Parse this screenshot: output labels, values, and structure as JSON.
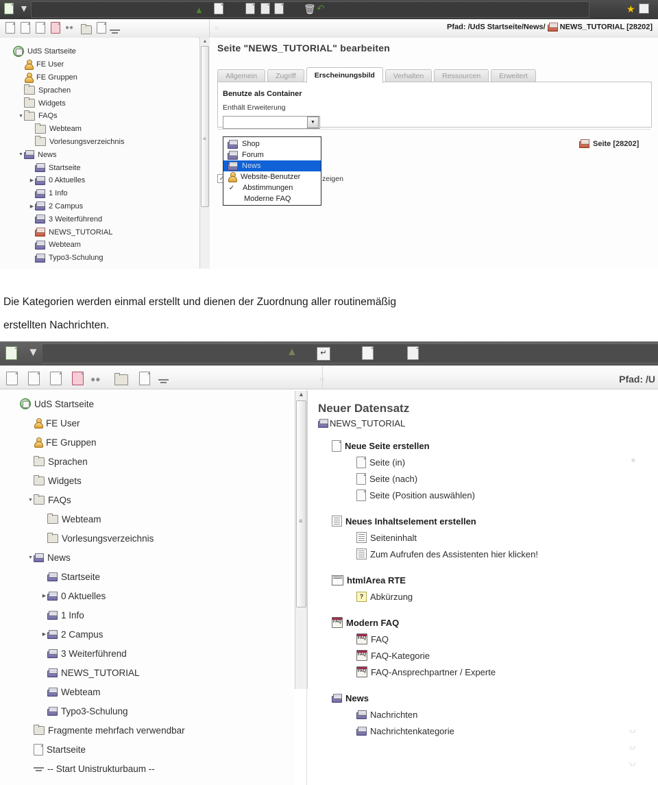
{
  "document": {
    "paragraph_line1": "Die Kategorien werden einmal erstellt und dienen der  Zuordnung aller routinemäßig",
    "paragraph_line2": "erstellten Nachrichten."
  },
  "screenshot1": {
    "toolbar_top": {
      "icons": [
        "new-page-icon",
        "filter-icon",
        "user-icon",
        "clipboard-icon",
        "save-document-icon",
        "save-and-view-icon",
        "save-and-close-icon",
        "delete-icon",
        "undo-icon",
        "bookmark-star-icon",
        "fullscreen-icon"
      ]
    },
    "toolbar_second": {
      "icons": [
        "page-icon",
        "page-edit-icon",
        "page-new-icon",
        "page-red-icon",
        "link-icon",
        "folder-icon",
        "info-icon",
        "divider-icon"
      ],
      "path_label": "Pfad:",
      "path_value": "/UdS Startseite/News/",
      "path_page": "NEWS_TUTORIAL [28202]"
    },
    "tree": {
      "items": [
        {
          "label": "UdS Startseite",
          "depth": 0,
          "icon": "globe-icon",
          "twist": ""
        },
        {
          "label": "FE User",
          "depth": 1,
          "icon": "user-icon",
          "twist": ""
        },
        {
          "label": "FE Gruppen",
          "depth": 1,
          "icon": "user-group-icon",
          "twist": ""
        },
        {
          "label": "Sprachen",
          "depth": 1,
          "icon": "folder-icon",
          "twist": ""
        },
        {
          "label": "Widgets",
          "depth": 1,
          "icon": "folder-icon",
          "twist": ""
        },
        {
          "label": "FAQs",
          "depth": 1,
          "icon": "folder-icon",
          "twist": "▼"
        },
        {
          "label": "Webteam",
          "depth": 2,
          "icon": "folder-icon",
          "twist": ""
        },
        {
          "label": "Vorlesungsverzeichnis",
          "depth": 2,
          "icon": "folder-icon",
          "twist": ""
        },
        {
          "label": "News",
          "depth": 1,
          "icon": "news-page-icon",
          "twist": "▼"
        },
        {
          "label": "Startseite",
          "depth": 2,
          "icon": "news-page-icon",
          "twist": ""
        },
        {
          "label": "0 Aktuelles",
          "depth": 2,
          "icon": "news-page-icon",
          "twist": "▶"
        },
        {
          "label": "1 Info",
          "depth": 2,
          "icon": "news-page-icon",
          "twist": ""
        },
        {
          "label": "2 Campus",
          "depth": 2,
          "icon": "news-page-icon",
          "twist": "▶"
        },
        {
          "label": "3 Weiterführend",
          "depth": 2,
          "icon": "news-page-icon",
          "twist": ""
        },
        {
          "label": "NEWS_TUTORIAL",
          "depth": 2,
          "icon": "news-page-red-icon",
          "twist": ""
        },
        {
          "label": "Webteam",
          "depth": 2,
          "icon": "news-page-icon",
          "twist": ""
        },
        {
          "label": "Typo3-Schulung",
          "depth": 2,
          "icon": "news-page-icon",
          "twist": ""
        }
      ]
    },
    "editor": {
      "heading": "Seite \"NEWS_TUTORIAL\" bearbeiten",
      "tabs": [
        {
          "label": "Allgemein",
          "active": false
        },
        {
          "label": "Zugriff",
          "active": false
        },
        {
          "label": "Erscheinungsbild",
          "active": true
        },
        {
          "label": "Verhalten",
          "active": false
        },
        {
          "label": "Ressourcen",
          "active": false
        },
        {
          "label": "Erweitert",
          "active": false
        }
      ],
      "field_group_label": "Benutze als Container",
      "field_label": "Enthält Erweiterung",
      "select_value": "",
      "dropdown_options": [
        {
          "label": "Shop",
          "icon": "shop-icon",
          "selected": false,
          "check": false
        },
        {
          "label": "Forum",
          "icon": "forum-icon",
          "selected": false,
          "check": false
        },
        {
          "label": "News",
          "icon": "news-icon",
          "selected": true,
          "check": false
        },
        {
          "label": "Website-Benutzer",
          "icon": "website-user-icon",
          "selected": false,
          "check": false
        },
        {
          "label": "Abstimmungen",
          "icon": "",
          "selected": false,
          "check": true
        },
        {
          "label": "Moderne FAQ",
          "icon": "",
          "selected": false,
          "check": false
        }
      ],
      "checkbox_row_text": "zeigen",
      "record_badge": "Seite [28202]"
    }
  },
  "screenshot2": {
    "toolbar_top": {
      "icons": [
        "new-page-icon",
        "filter-icon",
        "user-icon",
        "enter-icon",
        "new-record-icon",
        "history-icon"
      ]
    },
    "toolbar_second": {
      "icons": [
        "page-icon",
        "page-edit-icon",
        "page-new-icon",
        "page-red-icon",
        "link-icon",
        "folder-icon",
        "info-icon",
        "divider-icon"
      ],
      "path_label": "Pfad: /U"
    },
    "tree": {
      "items": [
        {
          "label": "UdS Startseite",
          "depth": 0,
          "icon": "globe-icon",
          "twist": ""
        },
        {
          "label": "FE User",
          "depth": 1,
          "icon": "user-icon",
          "twist": ""
        },
        {
          "label": "FE Gruppen",
          "depth": 1,
          "icon": "user-group-icon",
          "twist": ""
        },
        {
          "label": "Sprachen",
          "depth": 1,
          "icon": "folder-icon",
          "twist": ""
        },
        {
          "label": "Widgets",
          "depth": 1,
          "icon": "folder-icon",
          "twist": ""
        },
        {
          "label": "FAQs",
          "depth": 1,
          "icon": "folder-icon",
          "twist": "▼"
        },
        {
          "label": "Webteam",
          "depth": 2,
          "icon": "folder-icon",
          "twist": ""
        },
        {
          "label": "Vorlesungsverzeichnis",
          "depth": 2,
          "icon": "folder-icon",
          "twist": ""
        },
        {
          "label": "News",
          "depth": 1,
          "icon": "news-page-icon",
          "twist": "▼"
        },
        {
          "label": "Startseite",
          "depth": 2,
          "icon": "news-page-icon",
          "twist": ""
        },
        {
          "label": "0 Aktuelles",
          "depth": 2,
          "icon": "news-page-icon",
          "twist": "▶"
        },
        {
          "label": "1 Info",
          "depth": 2,
          "icon": "news-page-icon",
          "twist": ""
        },
        {
          "label": "2 Campus",
          "depth": 2,
          "icon": "news-page-icon",
          "twist": "▶"
        },
        {
          "label": "3 Weiterführend",
          "depth": 2,
          "icon": "news-page-icon",
          "twist": ""
        },
        {
          "label": "NEWS_TUTORIAL",
          "depth": 2,
          "icon": "news-page-icon",
          "twist": ""
        },
        {
          "label": "Webteam",
          "depth": 2,
          "icon": "news-page-icon",
          "twist": ""
        },
        {
          "label": "Typo3-Schulung",
          "depth": 2,
          "icon": "news-page-icon",
          "twist": ""
        },
        {
          "label": "Fragmente mehrfach verwendbar",
          "depth": 1,
          "icon": "folder-icon",
          "twist": ""
        },
        {
          "label": "Startseite",
          "depth": 1,
          "icon": "page-icon",
          "twist": ""
        },
        {
          "label": "-- Start Unistrukturbaum --",
          "depth": 1,
          "icon": "divider-icon",
          "twist": ""
        }
      ]
    },
    "newrecord": {
      "title": "Neuer Datensatz",
      "subtitle": "NEWS_TUTORIAL",
      "groups": [
        {
          "label": "Neue Seite erstellen",
          "icon": "new-page-icon",
          "items": [
            {
              "label": "Seite (in)",
              "icon": "page-icon"
            },
            {
              "label": "Seite (nach)",
              "icon": "page-icon"
            },
            {
              "label": "Seite (Position auswählen)",
              "icon": "page-position-icon"
            }
          ]
        },
        {
          "label": "Neues Inhaltselement erstellen",
          "icon": "new-content-icon",
          "items": [
            {
              "label": "Seiteninhalt",
              "icon": "content-icon"
            },
            {
              "label": "Zum Aufrufen des Assistenten hier klicken!",
              "icon": "wizard-icon"
            }
          ]
        },
        {
          "label": "htmlArea RTE",
          "icon": "rte-icon",
          "items": [
            {
              "label": "Abkürzung",
              "icon": "question-icon"
            }
          ]
        },
        {
          "label": "Modern FAQ",
          "icon": "faq-icon",
          "items": [
            {
              "label": "FAQ",
              "icon": "faq-icon"
            },
            {
              "label": "FAQ-Kategorie",
              "icon": "faq-category-icon"
            },
            {
              "label": "FAQ-Ansprechpartner / Experte",
              "icon": "faq-expert-icon"
            }
          ]
        },
        {
          "label": "News",
          "icon": "news-icon",
          "items": [
            {
              "label": "Nachrichten",
              "icon": "news-item-icon"
            },
            {
              "label": "Nachrichtenkategorie",
              "icon": "news-category-icon"
            }
          ]
        }
      ]
    }
  },
  "colors": {
    "toolbar_dark": "#414141",
    "selection_blue": "#1062d6",
    "accent_red": "#c2553a",
    "star_yellow": "#f3c300"
  }
}
